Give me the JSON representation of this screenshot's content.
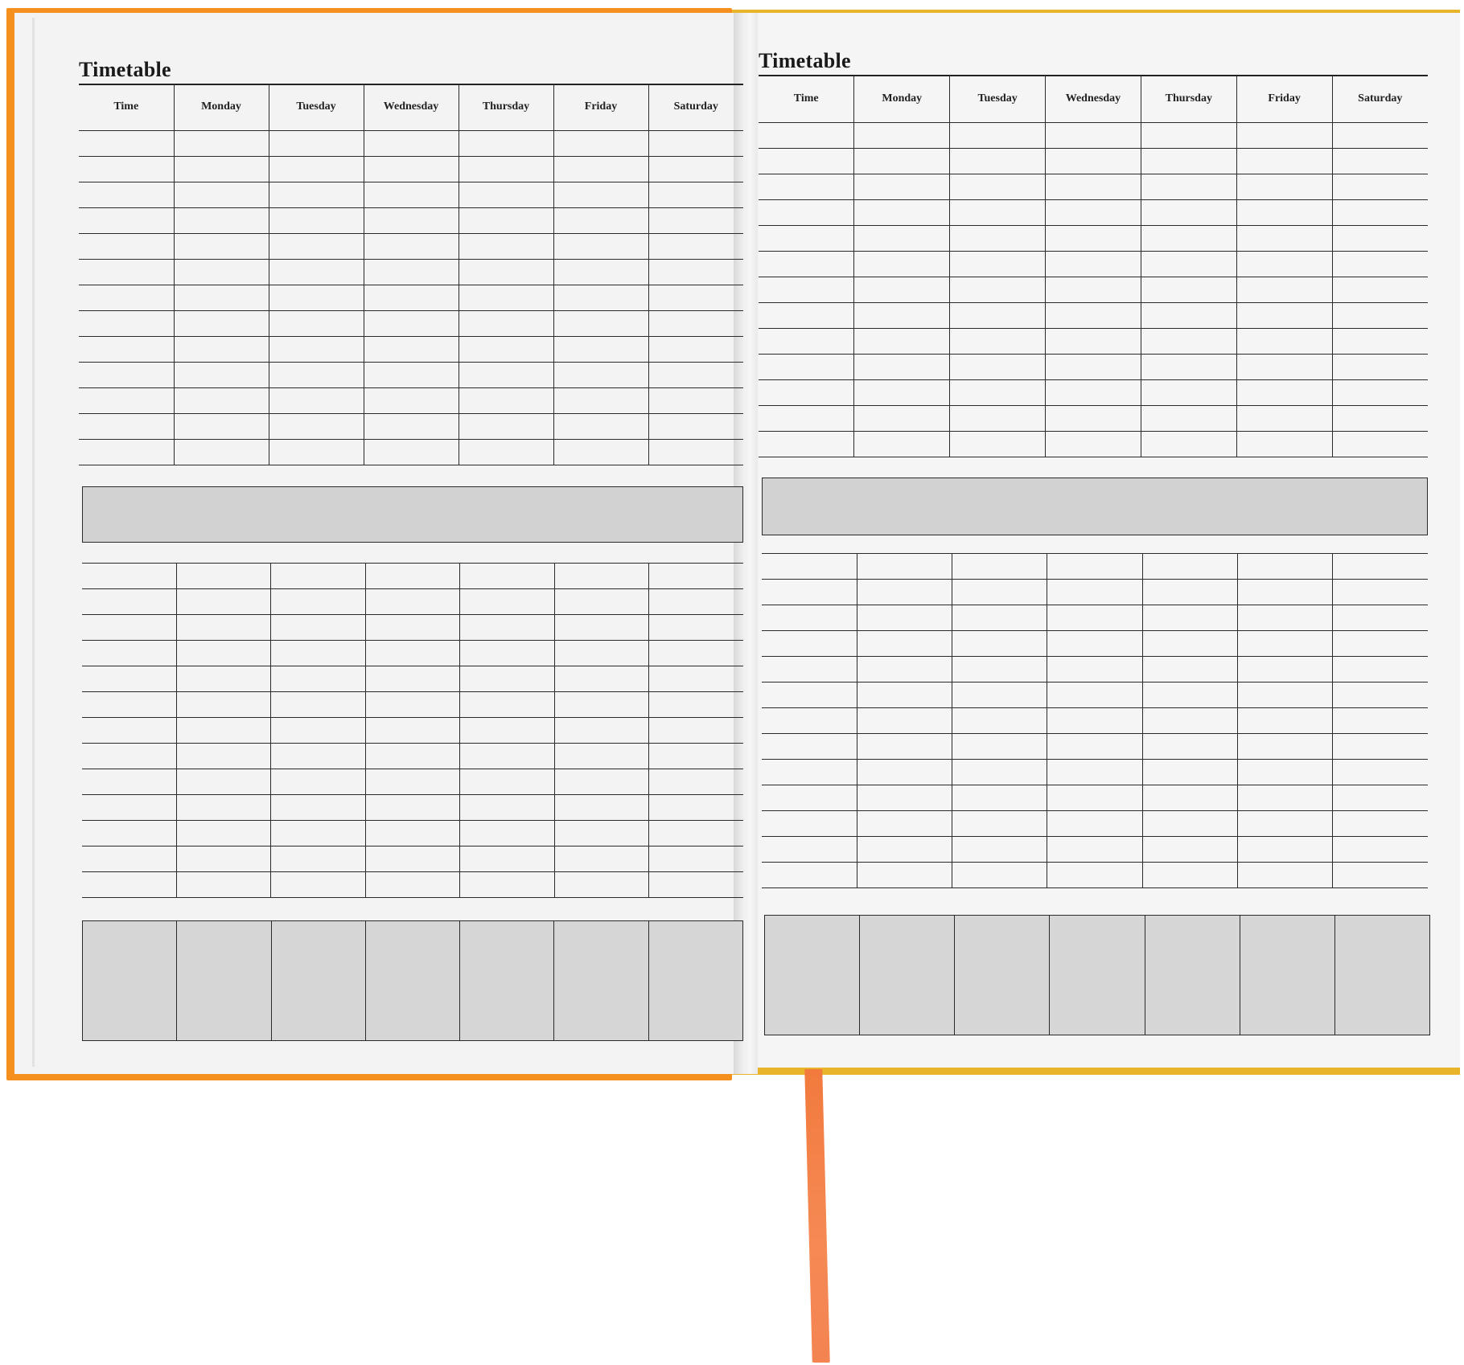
{
  "left_page": {
    "title": "Timetable",
    "headers": [
      "Time",
      "Monday",
      "Tuesday",
      "Wednesday",
      "Thursday",
      "Friday",
      "Saturday"
    ]
  },
  "right_page": {
    "title": "Timetable",
    "headers": [
      "Time",
      "Monday",
      "Tuesday",
      "Wednesday",
      "Thursday",
      "Friday",
      "Saturday"
    ]
  },
  "colors": {
    "cover": "#f5901e",
    "ribbon": "#f27a3d",
    "band": "#d2d2d2"
  }
}
